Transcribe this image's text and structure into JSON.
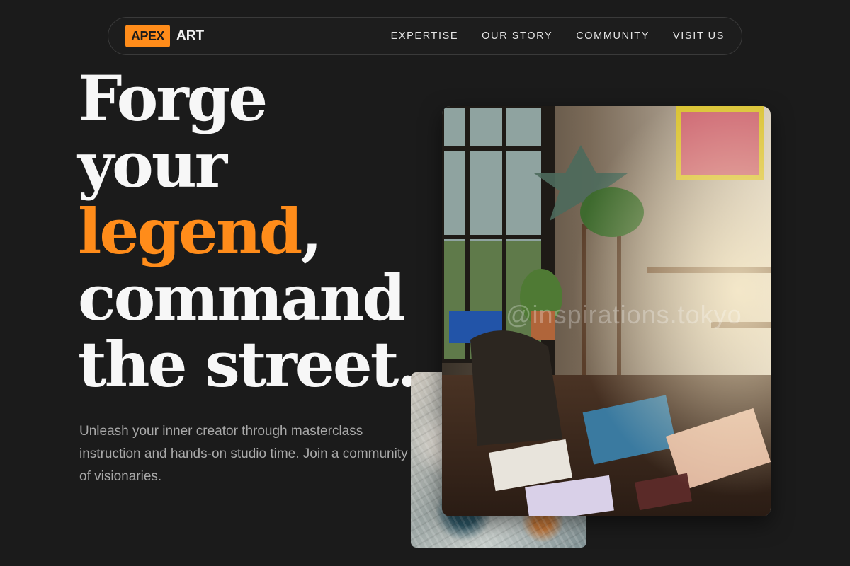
{
  "brand": {
    "badge": "APEX",
    "name": "ART",
    "accent_color": "#ff8c1a"
  },
  "nav": {
    "links": [
      "EXPERTISE",
      "OUR STORY",
      "COMMUNITY",
      "VISIT US"
    ]
  },
  "hero": {
    "headline": {
      "line1": "Forge",
      "line2": "your",
      "line3_accent": "legend",
      "line3_rest": ",",
      "line4": "command",
      "line5": "the street."
    },
    "subtext": "Unleash your inner creator through masterclass instruction and hands-on studio time. Join a community of visionaries."
  },
  "images": {
    "main_watermark": "@inspirations.tokyo"
  }
}
